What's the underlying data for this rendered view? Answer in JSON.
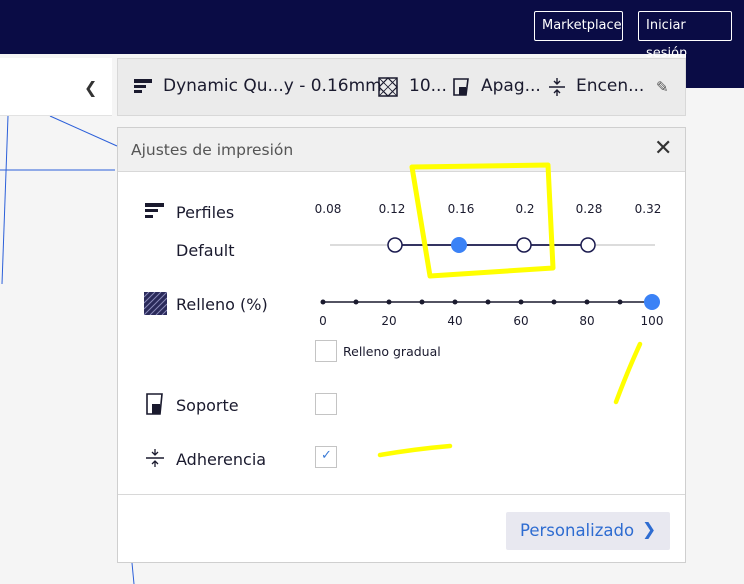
{
  "header": {
    "marketplace_label": "Marketplace",
    "login_label": "Iniciar sesión"
  },
  "summary": {
    "profile": "Dynamic Qu...y - 0.16mm",
    "infill": "10...",
    "support": "Apag...",
    "adhesion": "Encen..."
  },
  "panel": {
    "title": "Ajustes de impresión",
    "profiles_label": "Perfiles",
    "profiles_sublabel": "Default",
    "profile_ticks": [
      "0.08",
      "0.12",
      "0.16",
      "0.2",
      "0.28",
      "0.32"
    ],
    "profile_selected": "0.16",
    "infill_label": "Relleno (%)",
    "infill_ticks": [
      "0",
      "20",
      "40",
      "60",
      "80",
      "100"
    ],
    "infill_value": 100,
    "gradual_infill_label": "Relleno gradual",
    "gradual_infill_checked": false,
    "support_label": "Soporte",
    "support_checked": false,
    "adhesion_label": "Adherencia",
    "adhesion_checked": true,
    "custom_button": "Personalizado"
  },
  "colors": {
    "header_bg": "#0a0c45",
    "accent": "#3b82f6",
    "annotation": "#ffff00"
  }
}
